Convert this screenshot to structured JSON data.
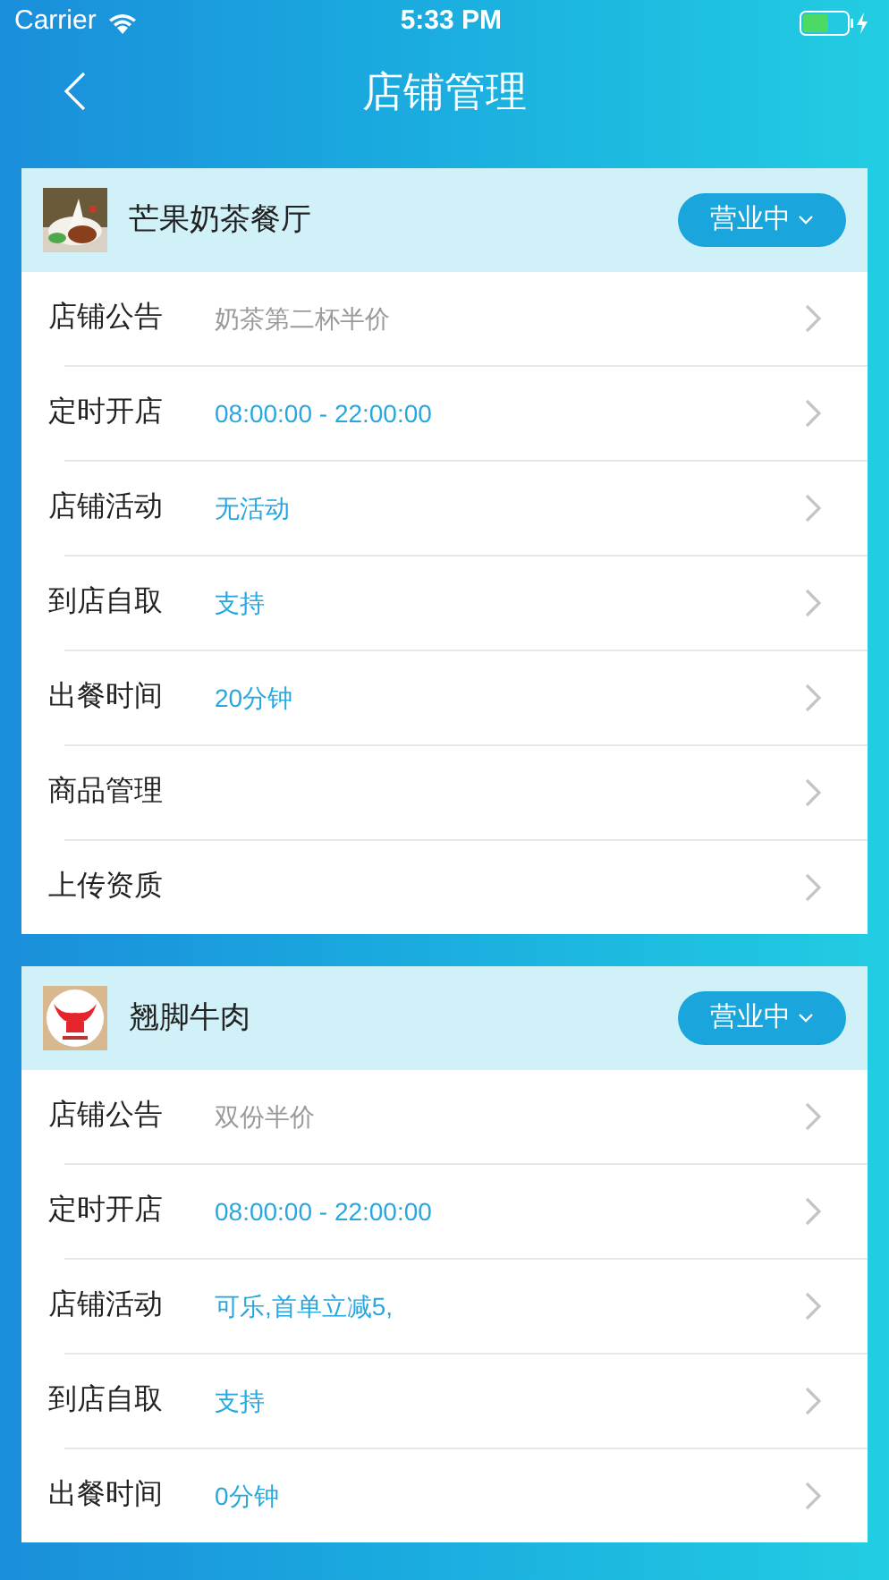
{
  "status_bar": {
    "carrier": "Carrier",
    "time": "5:33 PM"
  },
  "nav": {
    "title": "店铺管理"
  },
  "shops": [
    {
      "name": "芒果奶茶餐厅",
      "status": "营业中",
      "rows": [
        {
          "label": "店铺公告",
          "value": "奶茶第二杯半价",
          "kind": "muted"
        },
        {
          "label": "定时开店",
          "value": "08:00:00 - 22:00:00",
          "kind": "accent"
        },
        {
          "label": "店铺活动",
          "value": "无活动",
          "kind": "accent"
        },
        {
          "label": "到店自取",
          "value": "支持",
          "kind": "accent"
        },
        {
          "label": "出餐时间",
          "value": "20分钟",
          "kind": "accent"
        },
        {
          "label": "商品管理"
        },
        {
          "label": "上传资质"
        }
      ]
    },
    {
      "name": "翘脚牛肉",
      "status": "营业中",
      "rows": [
        {
          "label": "店铺公告",
          "value": "双份半价",
          "kind": "muted"
        },
        {
          "label": "定时开店",
          "value": "08:00:00 - 22:00:00",
          "kind": "accent"
        },
        {
          "label": "店铺活动",
          "value": "可乐,首单立减5,",
          "kind": "accent"
        },
        {
          "label": "到店自取",
          "value": "支持",
          "kind": "accent"
        },
        {
          "label": "出餐时间",
          "value": "0分钟",
          "kind": "accent"
        }
      ]
    }
  ]
}
